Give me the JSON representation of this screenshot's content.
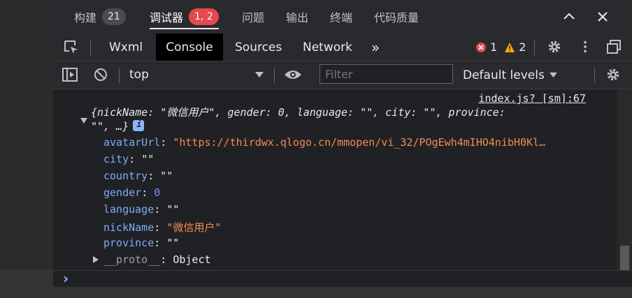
{
  "tabs": [
    {
      "label": "构建",
      "badge": "21"
    },
    {
      "label": "调试器",
      "badge": "1, 2"
    },
    {
      "label": "问题"
    },
    {
      "label": "输出"
    },
    {
      "label": "终端"
    },
    {
      "label": "代码质量"
    }
  ],
  "devtools": {
    "tabs": [
      "Wxml",
      "Console",
      "Sources",
      "Network"
    ],
    "more": "»",
    "error_count": "1",
    "warning_count": "2"
  },
  "console_toolbar": {
    "context": "top",
    "filter_placeholder": "Filter",
    "levels": "Default levels"
  },
  "console": {
    "source_link": "index.js? [sm]:67",
    "summary_line1": "{nickName: \"微信用户\", gender: 0, language: \"\", city: \"\", province:",
    "summary_line2": "\"\", …}",
    "props": [
      {
        "key": "avatarUrl",
        "value": "\"https://thirdwx.qlogo.cn/mmopen/vi_32/POgEwh4mIHO4nibH0Kl…",
        "type": "string"
      },
      {
        "key": "city",
        "value": "\"\"",
        "type": "string"
      },
      {
        "key": "country",
        "value": "\"\"",
        "type": "string"
      },
      {
        "key": "gender",
        "value": "0",
        "type": "number"
      },
      {
        "key": "language",
        "value": "\"\"",
        "type": "string"
      },
      {
        "key": "nickName",
        "value": "\"微信用户\"",
        "type": "string"
      },
      {
        "key": "province",
        "value": "\"\"",
        "type": "string"
      }
    ],
    "proto_key": "__proto__",
    "proto_value": "Object",
    "prompt": "›"
  },
  "colors": {
    "key": "#7cacf8",
    "string": "#f28b54",
    "number": "#9980ff",
    "error": "#e5484d",
    "warning": "#f9ab00"
  }
}
